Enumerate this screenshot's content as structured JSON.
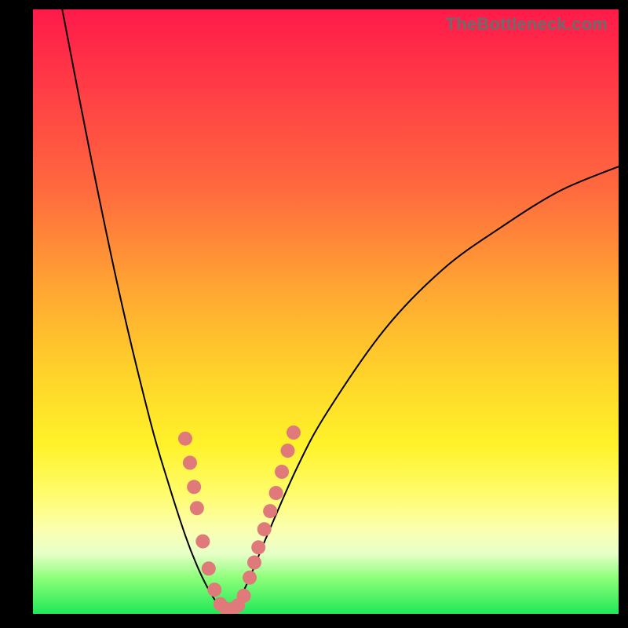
{
  "watermark": {
    "text": "TheBottleneck.com"
  },
  "colors": {
    "frame": "#000000",
    "curve": "#000000",
    "dot": "#e07a7a",
    "gradient_stops": [
      "#ff1a4a",
      "#ff3a46",
      "#ff6a3e",
      "#ffa533",
      "#ffd22a",
      "#fff22a",
      "#fffc6a",
      "#fbffb0",
      "#e8ffc8",
      "#8dff7a",
      "#20e858"
    ]
  },
  "chart_data": {
    "type": "line",
    "title": "",
    "xlabel": "",
    "ylabel": "",
    "xlim": [
      0,
      100
    ],
    "ylim": [
      0,
      100
    ],
    "series": [
      {
        "name": "left-curve",
        "x": [
          5,
          10,
          15,
          20,
          23,
          26,
          28,
          30,
          32,
          33
        ],
        "y": [
          100,
          75,
          52,
          32,
          22,
          13,
          8,
          4,
          1,
          0
        ]
      },
      {
        "name": "right-curve",
        "x": [
          33,
          35,
          37,
          40,
          45,
          50,
          60,
          70,
          80,
          90,
          100
        ],
        "y": [
          0,
          2,
          6,
          13,
          24,
          33,
          47,
          57,
          64,
          70,
          74
        ]
      }
    ],
    "marker_points": {
      "name": "dots",
      "comment": "salmon dots clustered near the valley on both branches",
      "points": [
        {
          "x": 26.0,
          "y": 29.0
        },
        {
          "x": 26.8,
          "y": 25.0
        },
        {
          "x": 27.5,
          "y": 21.0
        },
        {
          "x": 28.0,
          "y": 17.5
        },
        {
          "x": 29.0,
          "y": 12.0
        },
        {
          "x": 30.0,
          "y": 7.5
        },
        {
          "x": 31.0,
          "y": 4.0
        },
        {
          "x": 32.0,
          "y": 1.6
        },
        {
          "x": 33.0,
          "y": 0.8
        },
        {
          "x": 34.0,
          "y": 0.8
        },
        {
          "x": 35.0,
          "y": 1.4
        },
        {
          "x": 36.0,
          "y": 3.0
        },
        {
          "x": 37.0,
          "y": 6.0
        },
        {
          "x": 37.8,
          "y": 8.5
        },
        {
          "x": 38.5,
          "y": 11.0
        },
        {
          "x": 39.5,
          "y": 14.0
        },
        {
          "x": 40.5,
          "y": 17.0
        },
        {
          "x": 41.5,
          "y": 20.0
        },
        {
          "x": 42.5,
          "y": 23.5
        },
        {
          "x": 43.5,
          "y": 27.0
        },
        {
          "x": 44.5,
          "y": 30.0
        }
      ]
    }
  }
}
